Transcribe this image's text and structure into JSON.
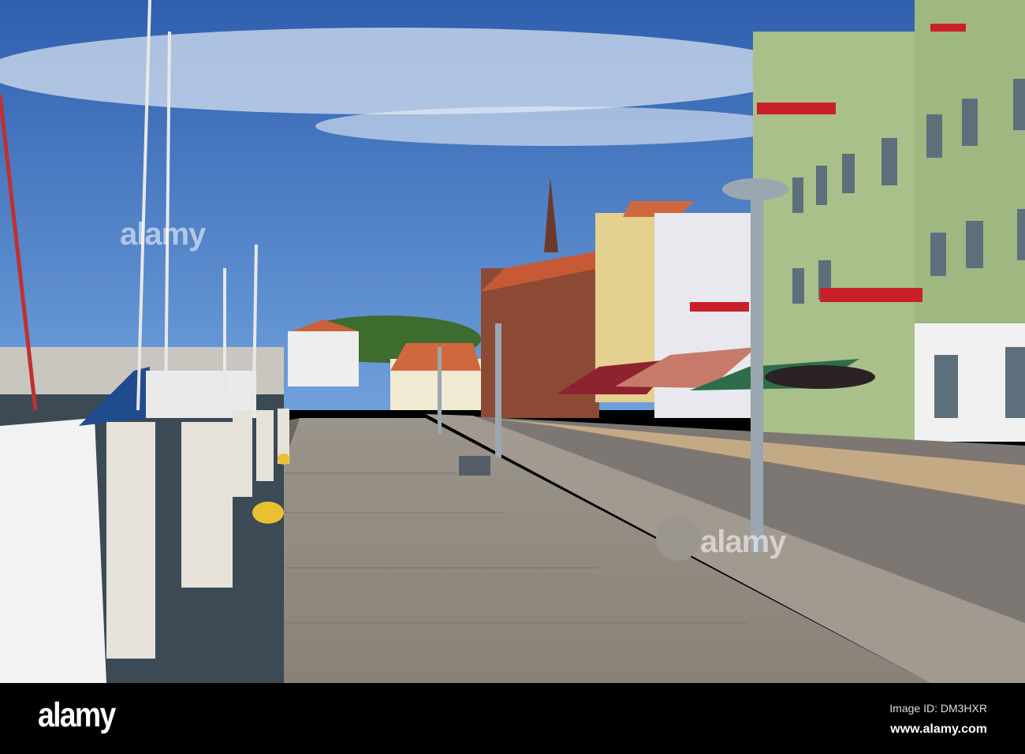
{
  "watermark": {
    "logo": "alamy"
  },
  "footer": {
    "logo": "alamy",
    "image_id": "Image ID: DM3HXR",
    "url": "www.alamy.com"
  },
  "colors": {
    "sky": "#3f74c0",
    "boardwalk": "#8f8a80",
    "building_green": "#a9c08a",
    "roof": "#c8603a",
    "footer": "#000000"
  }
}
